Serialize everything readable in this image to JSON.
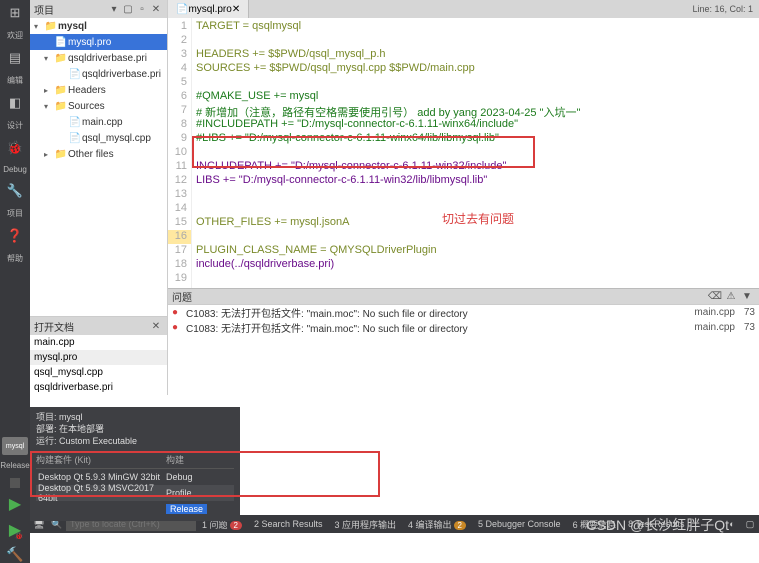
{
  "leftbar": {
    "items": [
      "欢迎",
      "编辑",
      "设计",
      "Debug",
      "项目",
      "帮助"
    ],
    "mysql": "mysql",
    "release": "Release"
  },
  "project": {
    "title": "项目",
    "root": "mysql",
    "nodes": {
      "pro": "mysql.pro",
      "drvbase": "qsqldriverbase.pri",
      "headers": "Headers",
      "sources": "Sources",
      "main": "main.cpp",
      "qsqlcpp": "qsql_mysql.cpp",
      "other": "Other files"
    }
  },
  "editor": {
    "tab": "mysql.pro",
    "lineinfo": "Line: 16, Col: 1",
    "lines": [
      "TARGET = qsqlmysql",
      "",
      "HEADERS += $$PWD/qsql_mysql_p.h",
      "SOURCES += $$PWD/qsql_mysql.cpp $$PWD/main.cpp",
      "",
      "#QMAKE_USE += mysql",
      "# 新增加（注意，路径有空格需要使用引号） add by yang 2023-04-25 \"入坑一\"",
      "#INCLUDEPATH += \"D:/mysql-connector-c-6.1.11-winx64/include\"",
      "#LIBS += \"D:/mysql-connector-c-6.1.11-winx64/lib/libmysql.lib\"",
      "",
      "INCLUDEPATH += \"D:/mysql-connector-c-6.1.11-win32/include\"",
      "LIBS += \"D:/mysql-connector-c-6.1.11-win32/lib/libmysql.lib\"",
      "",
      "",
      "OTHER_FILES += mysql.jsonA",
      "",
      "PLUGIN_CLASS_NAME = QMYSQLDriverPlugin",
      "include(../qsqldriverbase.pri)",
      ""
    ],
    "annotation": "切过去有问题"
  },
  "issues": {
    "title": "问题",
    "rows": [
      {
        "msg": "C1083: 无法打开包括文件: \"main.moc\": No such file or directory",
        "file": "main.cpp",
        "line": "73"
      },
      {
        "msg": "C1083: 无法打开包括文件: \"main.moc\": No such file or directory",
        "file": "main.cpp",
        "line": "73"
      }
    ]
  },
  "opendocs": {
    "title": "打开文档",
    "items": [
      "main.cpp",
      "mysql.pro",
      "qsql_mysql.cpp",
      "qsqldriverbase.pri"
    ]
  },
  "kits": {
    "hdr": {
      "a": "项目: mysql",
      "b": "部署: 在本地部署",
      "c": "运行: Custom Executable"
    },
    "col1": "构建套件 (Kit)",
    "col2": "构建",
    "rows": [
      {
        "kit": "Desktop Qt 5.9.3 MinGW 32bit",
        "cfg": "Debug"
      },
      {
        "kit": "Desktop Qt 5.9.3 MSVC2017 64bit",
        "cfg": "Profile"
      },
      {
        "kit": "",
        "cfg": "Release"
      }
    ]
  },
  "status": {
    "search_ph": "Type to locate (Ctrl+K)",
    "items": [
      "1 问题",
      "2 Search Results",
      "3 应用程序输出",
      "4 编译输出",
      "5 Debugger Console",
      "6 概要信息",
      "8 Test Results"
    ],
    "badge1": "2",
    "badge2": "2"
  },
  "watermark": "CSDN @长沙红胖子Qt"
}
